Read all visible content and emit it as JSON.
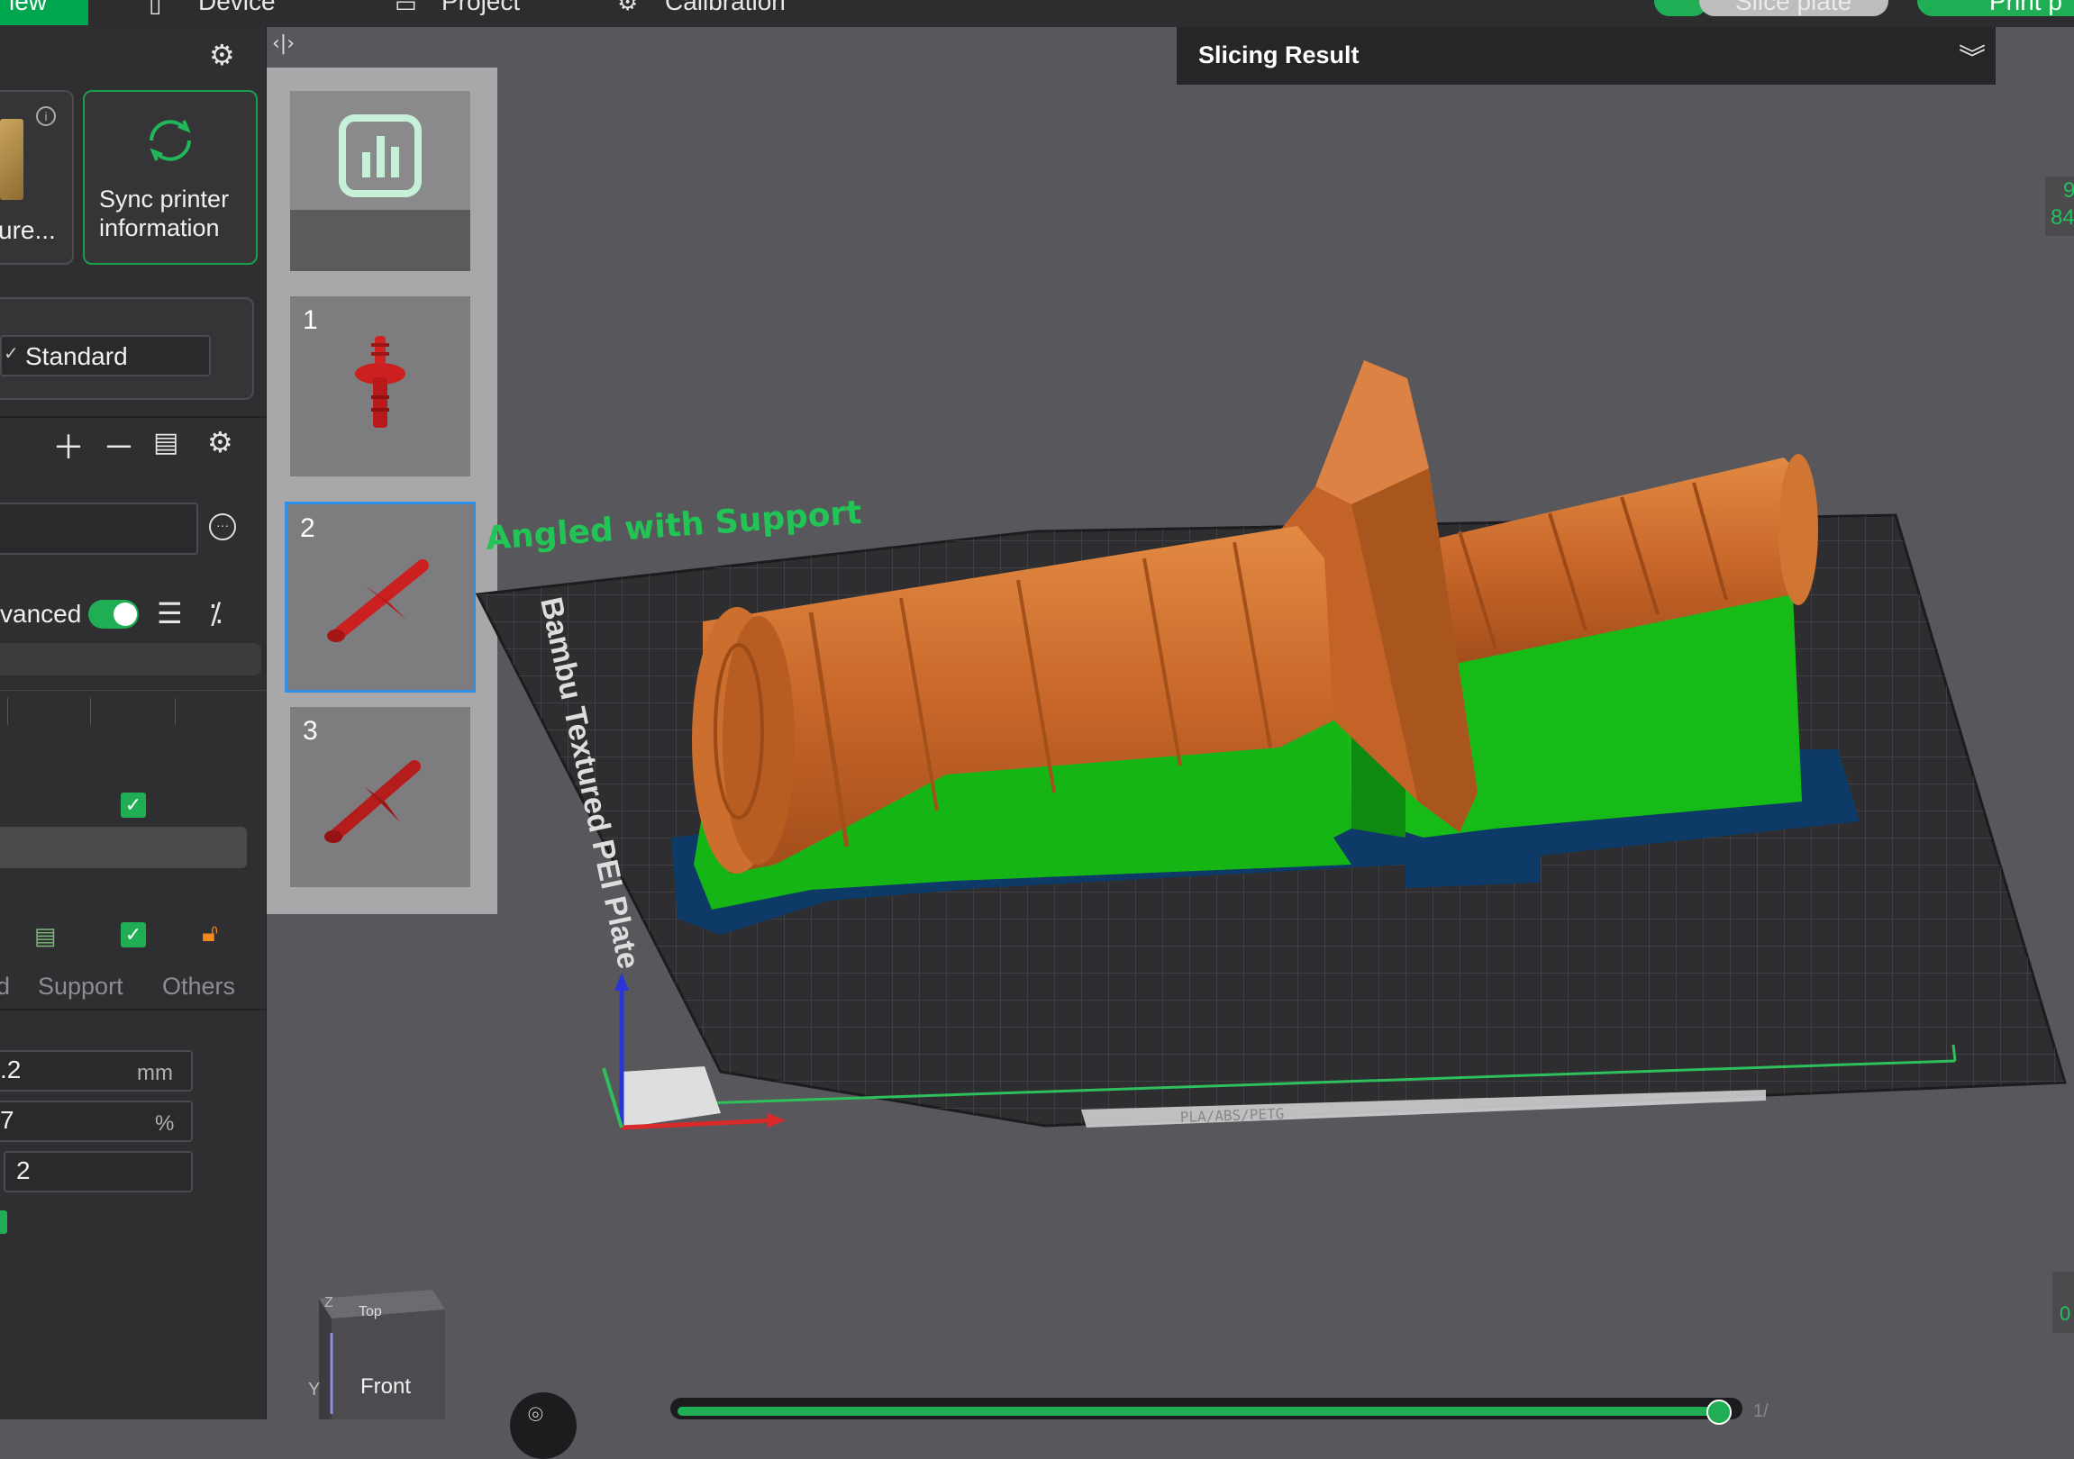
{
  "topbar": {
    "tab_left_partial": "iew",
    "tab_device": "Device",
    "tab_project": "Project",
    "tab_calibration": "Calibration",
    "slice_button": "Slice plate",
    "print_button": "Print p"
  },
  "left_panel": {
    "plate_type_partial": "ure...",
    "sync_label_line1": "Sync printer",
    "sync_label_line2": "information",
    "process_preset": "Standard",
    "advanced_partial": "vanced",
    "tabs": [
      "d",
      "Support",
      "Others"
    ],
    "layer_height_value": ".2",
    "layer_height_unit": "mm",
    "percent_value": "7",
    "percent_unit": "%",
    "wall_loops_value": "2"
  },
  "plate_list": {
    "plates": [
      {
        "number": "1"
      },
      {
        "number": "2"
      },
      {
        "number": "3"
      }
    ]
  },
  "viewport": {
    "slicing_result_title": "Slicing Result",
    "plate_label": "Bambu Textured PEI Plate",
    "object_label": "Angled with Support",
    "plate_strip_text": "PLA/ABS/PETG",
    "right_edge_numbers": [
      "9",
      "84"
    ],
    "nav_cube_top": "Top",
    "nav_cube_front": "Front",
    "nav_cube_z": "Z",
    "nav_cube_y": "Y",
    "right_edge_partial": "0",
    "slider_partial": "1/"
  },
  "colors": {
    "accent_green": "#00a64e",
    "object_orange": "#c8672a",
    "support_green": "#14b515",
    "brim_blue": "#0d3a66",
    "plate_dark": "#2e2e30",
    "selected_border": "#2f8fe8",
    "model_red": "#cc1f1f"
  }
}
